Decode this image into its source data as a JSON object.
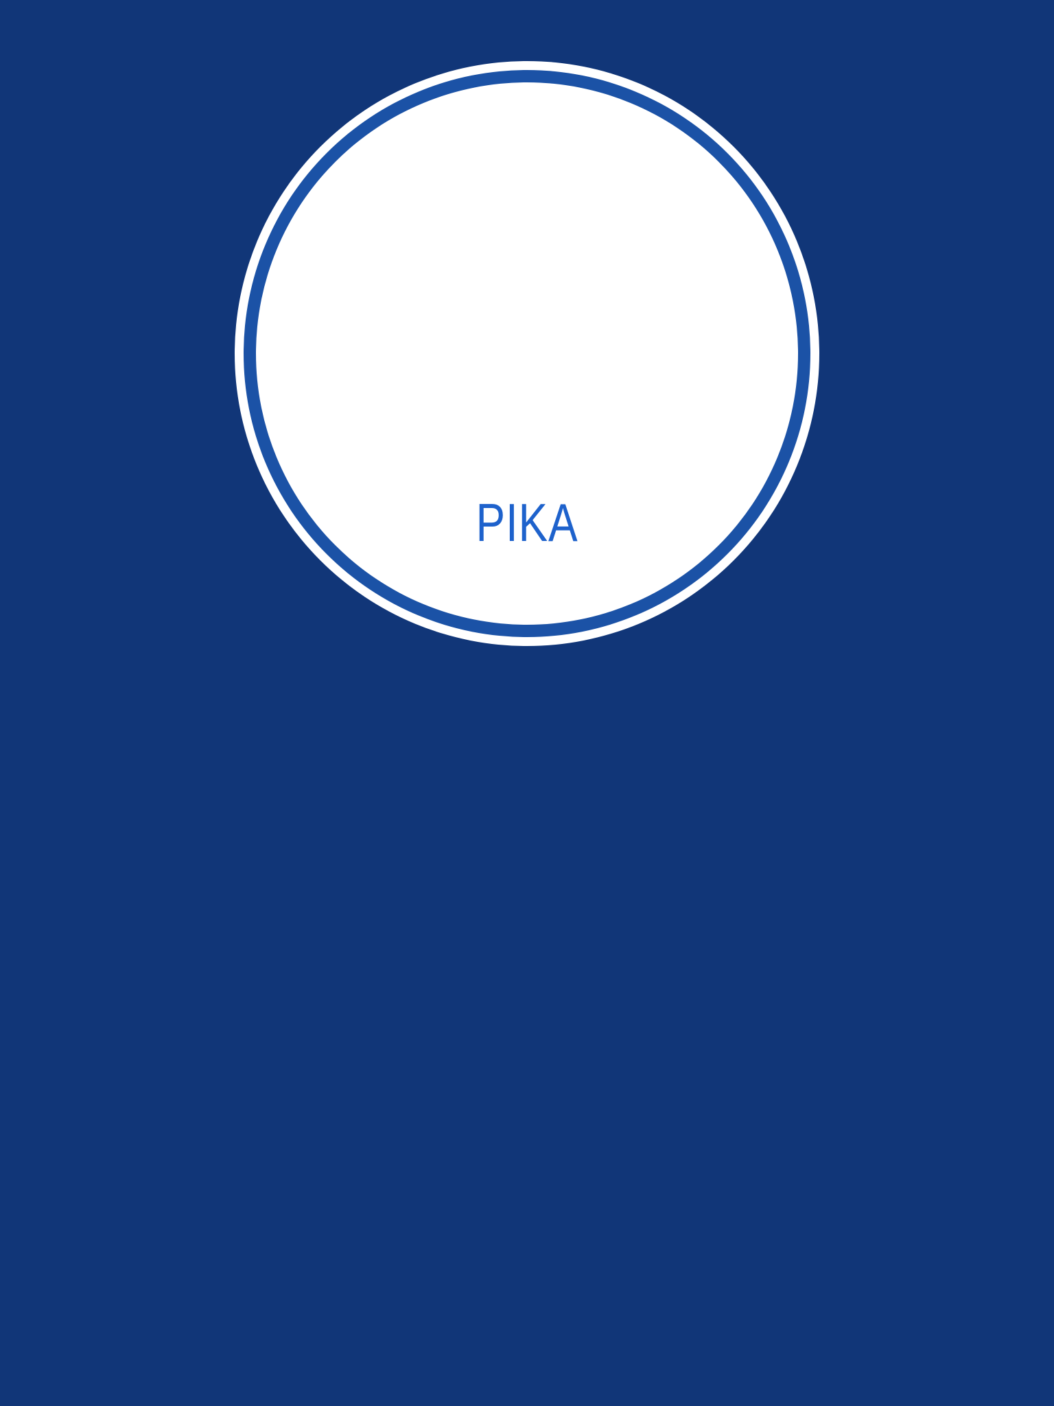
{
  "badge": {
    "label": "PIKA"
  },
  "colors": {
    "background": "#113678",
    "ring": "#1b52a6",
    "text": "#1e62cc"
  }
}
